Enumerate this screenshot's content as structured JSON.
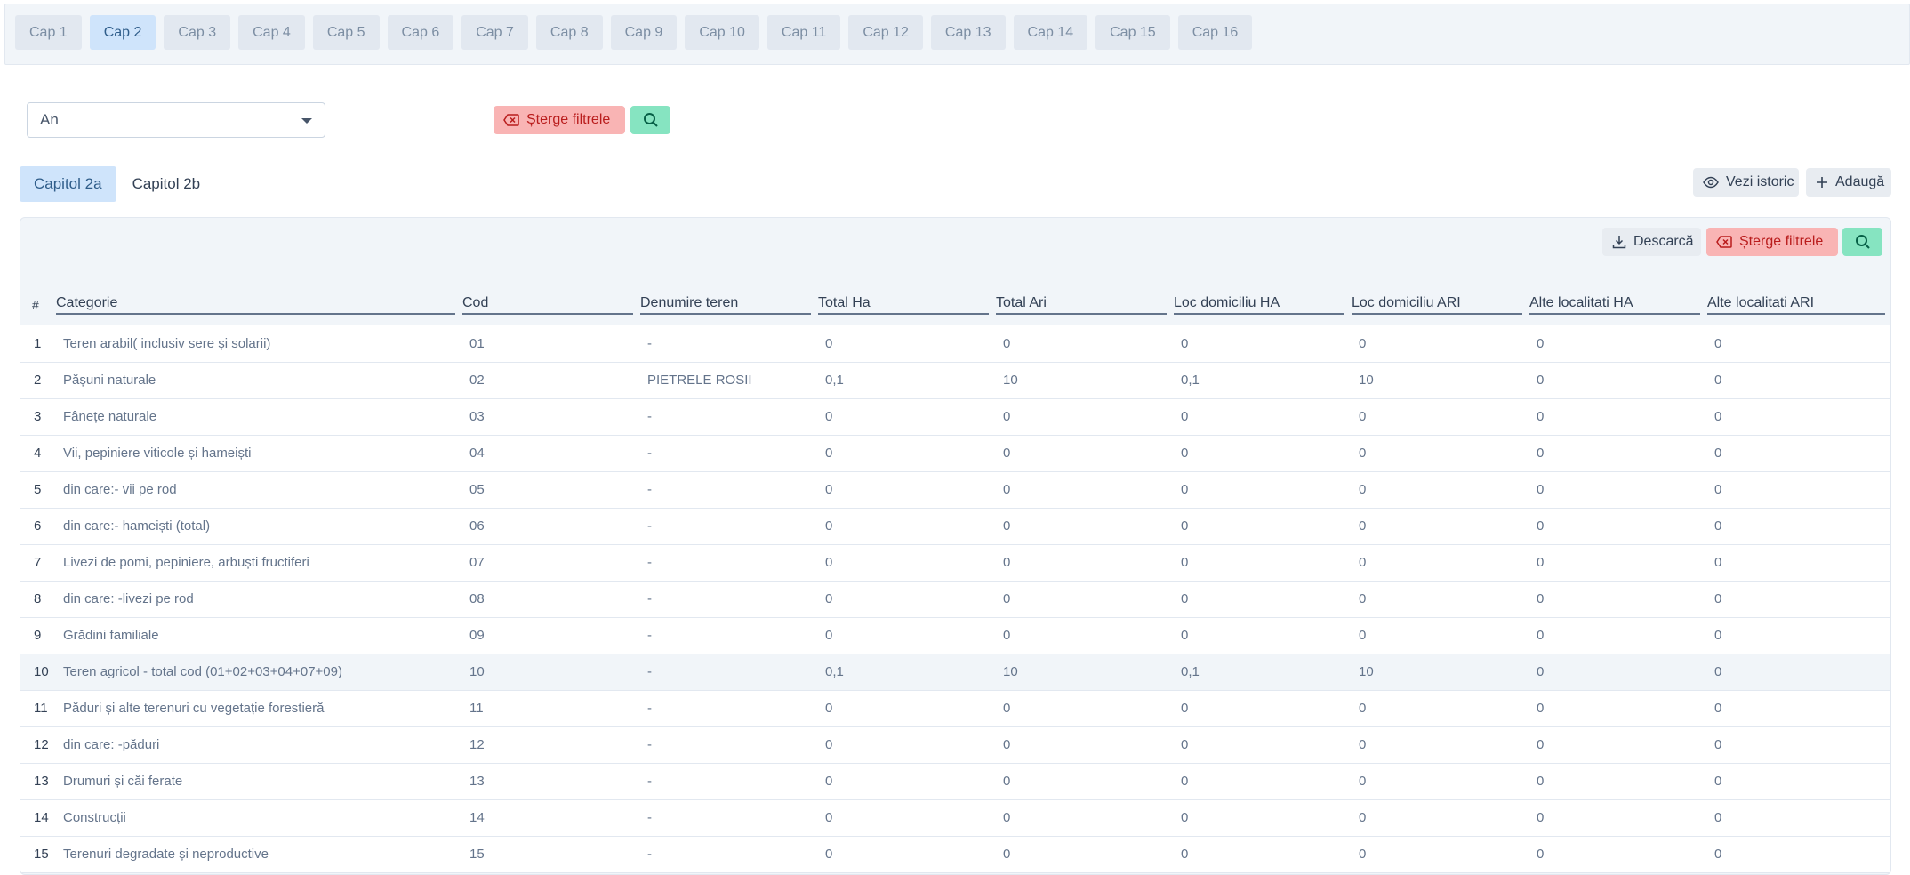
{
  "cap_tabs": [
    "Cap 1",
    "Cap 2",
    "Cap 3",
    "Cap 4",
    "Cap 5",
    "Cap 6",
    "Cap 7",
    "Cap 8",
    "Cap 9",
    "Cap 10",
    "Cap 11",
    "Cap 12",
    "Cap 13",
    "Cap 14",
    "Cap 15",
    "Cap 16"
  ],
  "active_cap": "Cap 2",
  "filter": {
    "year_value": "An",
    "clear_label": "Șterge filtrele"
  },
  "sub_tabs": {
    "a": "Capitol 2a",
    "b": "Capitol 2b"
  },
  "actions": {
    "history": "Vezi istoric",
    "add": "Adaugă"
  },
  "panel_actions": {
    "download": "Descarcă",
    "clear": "Șterge filtrele"
  },
  "table": {
    "headers": [
      "#",
      "Categorie",
      "Cod",
      "Denumire teren",
      "Total Ha",
      "Total Ari",
      "Loc domiciliu HA",
      "Loc domiciliu ARI",
      "Alte localitati HA",
      "Alte localitati ARI"
    ],
    "rows": [
      [
        "1",
        "Teren arabil( inclusiv sere și solarii)",
        "01",
        "-",
        "0",
        "0",
        "0",
        "0",
        "0",
        "0"
      ],
      [
        "2",
        "Pășuni naturale",
        "02",
        "PIETRELE ROSII",
        "0,1",
        "10",
        "0,1",
        "10",
        "0",
        "0"
      ],
      [
        "3",
        "Fânețe naturale",
        "03",
        "-",
        "0",
        "0",
        "0",
        "0",
        "0",
        "0"
      ],
      [
        "4",
        "Vii, pepiniere viticole și hameiști",
        "04",
        "-",
        "0",
        "0",
        "0",
        "0",
        "0",
        "0"
      ],
      [
        "5",
        "din care:- vii pe rod",
        "05",
        "-",
        "0",
        "0",
        "0",
        "0",
        "0",
        "0"
      ],
      [
        "6",
        "din care:- hameiști (total)",
        "06",
        "-",
        "0",
        "0",
        "0",
        "0",
        "0",
        "0"
      ],
      [
        "7",
        "Livezi de pomi, pepiniere, arbuști fructiferi",
        "07",
        "-",
        "0",
        "0",
        "0",
        "0",
        "0",
        "0"
      ],
      [
        "8",
        "din care: -livezi pe rod",
        "08",
        "-",
        "0",
        "0",
        "0",
        "0",
        "0",
        "0"
      ],
      [
        "9",
        "Grădini familiale",
        "09",
        "-",
        "0",
        "0",
        "0",
        "0",
        "0",
        "0"
      ],
      [
        "10",
        "Teren agricol - total cod (01+02+03+04+07+09)",
        "10",
        "-",
        "0,1",
        "10",
        "0,1",
        "10",
        "0",
        "0"
      ],
      [
        "11",
        "Păduri și alte terenuri cu vegetație forestieră",
        "11",
        "-",
        "0",
        "0",
        "0",
        "0",
        "0",
        "0"
      ],
      [
        "12",
        "din care: -păduri",
        "12",
        "-",
        "0",
        "0",
        "0",
        "0",
        "0",
        "0"
      ],
      [
        "13",
        "Drumuri și căi ferate",
        "13",
        "-",
        "0",
        "0",
        "0",
        "0",
        "0",
        "0"
      ],
      [
        "14",
        "Construcții",
        "14",
        "-",
        "0",
        "0",
        "0",
        "0",
        "0",
        "0"
      ],
      [
        "15",
        "Terenuri degradate și neproductive",
        "15",
        "-",
        "0",
        "0",
        "0",
        "0",
        "0",
        "0"
      ]
    ]
  },
  "colors": {
    "accent_blue": "#cfe4fb",
    "danger": "#f9b4b4",
    "success": "#86e4c1"
  },
  "icons": {
    "clear": "tag-x-icon",
    "search": "search-icon",
    "history": "eye-icon",
    "add": "plus-icon",
    "download": "download-icon"
  }
}
